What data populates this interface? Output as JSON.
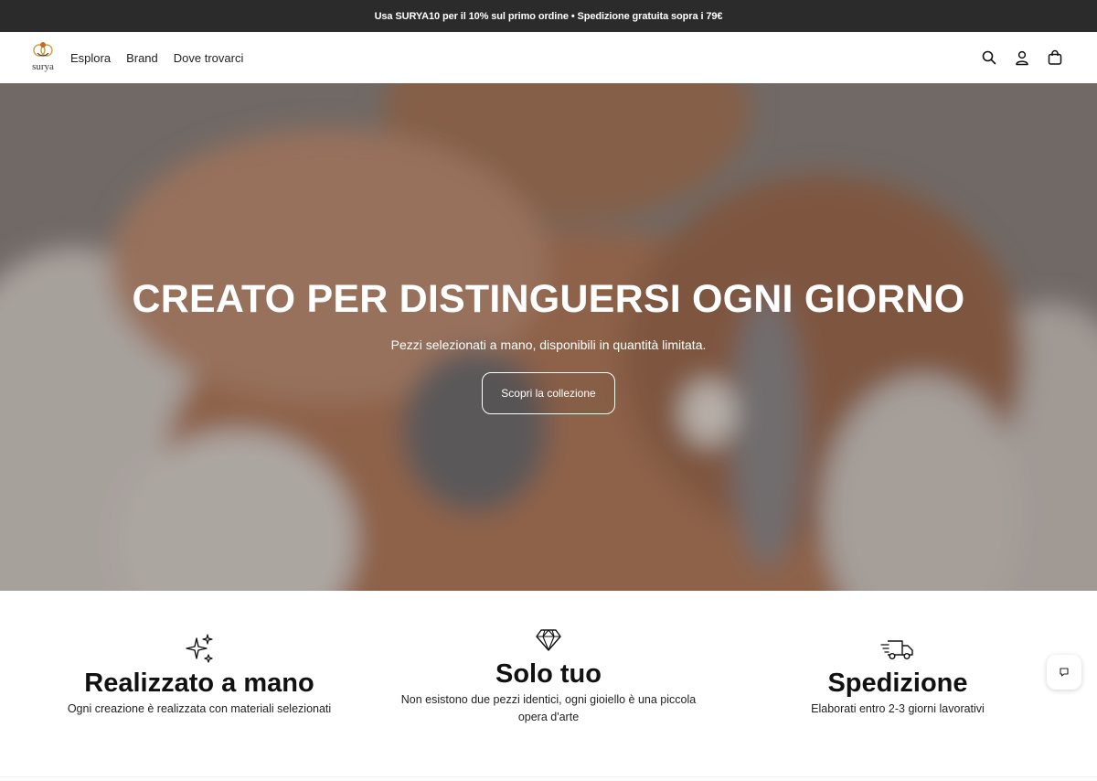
{
  "announcement": {
    "text": "Usa SURYA10 per il 10% sul primo ordine • Spedizione gratuita sopra i 79€"
  },
  "header": {
    "logo_text": "surya",
    "nav": [
      {
        "label": "Esplora"
      },
      {
        "label": "Brand"
      },
      {
        "label": "Dove trovarci"
      }
    ],
    "icons": [
      "search-icon",
      "account-icon",
      "cart-icon"
    ]
  },
  "hero": {
    "title": "CREATO PER DISTINGUERSI OGNI GIORNO",
    "subtitle": "Pezzi selezionati a mano, disponibili in quantità limitata.",
    "cta_label": "Scopri la collezione"
  },
  "features": [
    {
      "icon": "sparkles-icon",
      "title": "Realizzato a mano",
      "description": "Ogni creazione è realizzata con materiali selezionati"
    },
    {
      "icon": "diamond-icon",
      "title": "Solo tuo",
      "description": "Non esistono due pezzi identici, ogni gioiello è una piccola opera d'arte"
    },
    {
      "icon": "delivery-truck-icon",
      "title": "Spedizione",
      "description": "Elaborati entro 2-3 giorni lavorativi"
    }
  ],
  "chat": {
    "icon": "chat-icon"
  },
  "colors": {
    "announcement_bg": "#2b2b2b",
    "text": "#111111",
    "logo_accent": "#c9a24a"
  }
}
